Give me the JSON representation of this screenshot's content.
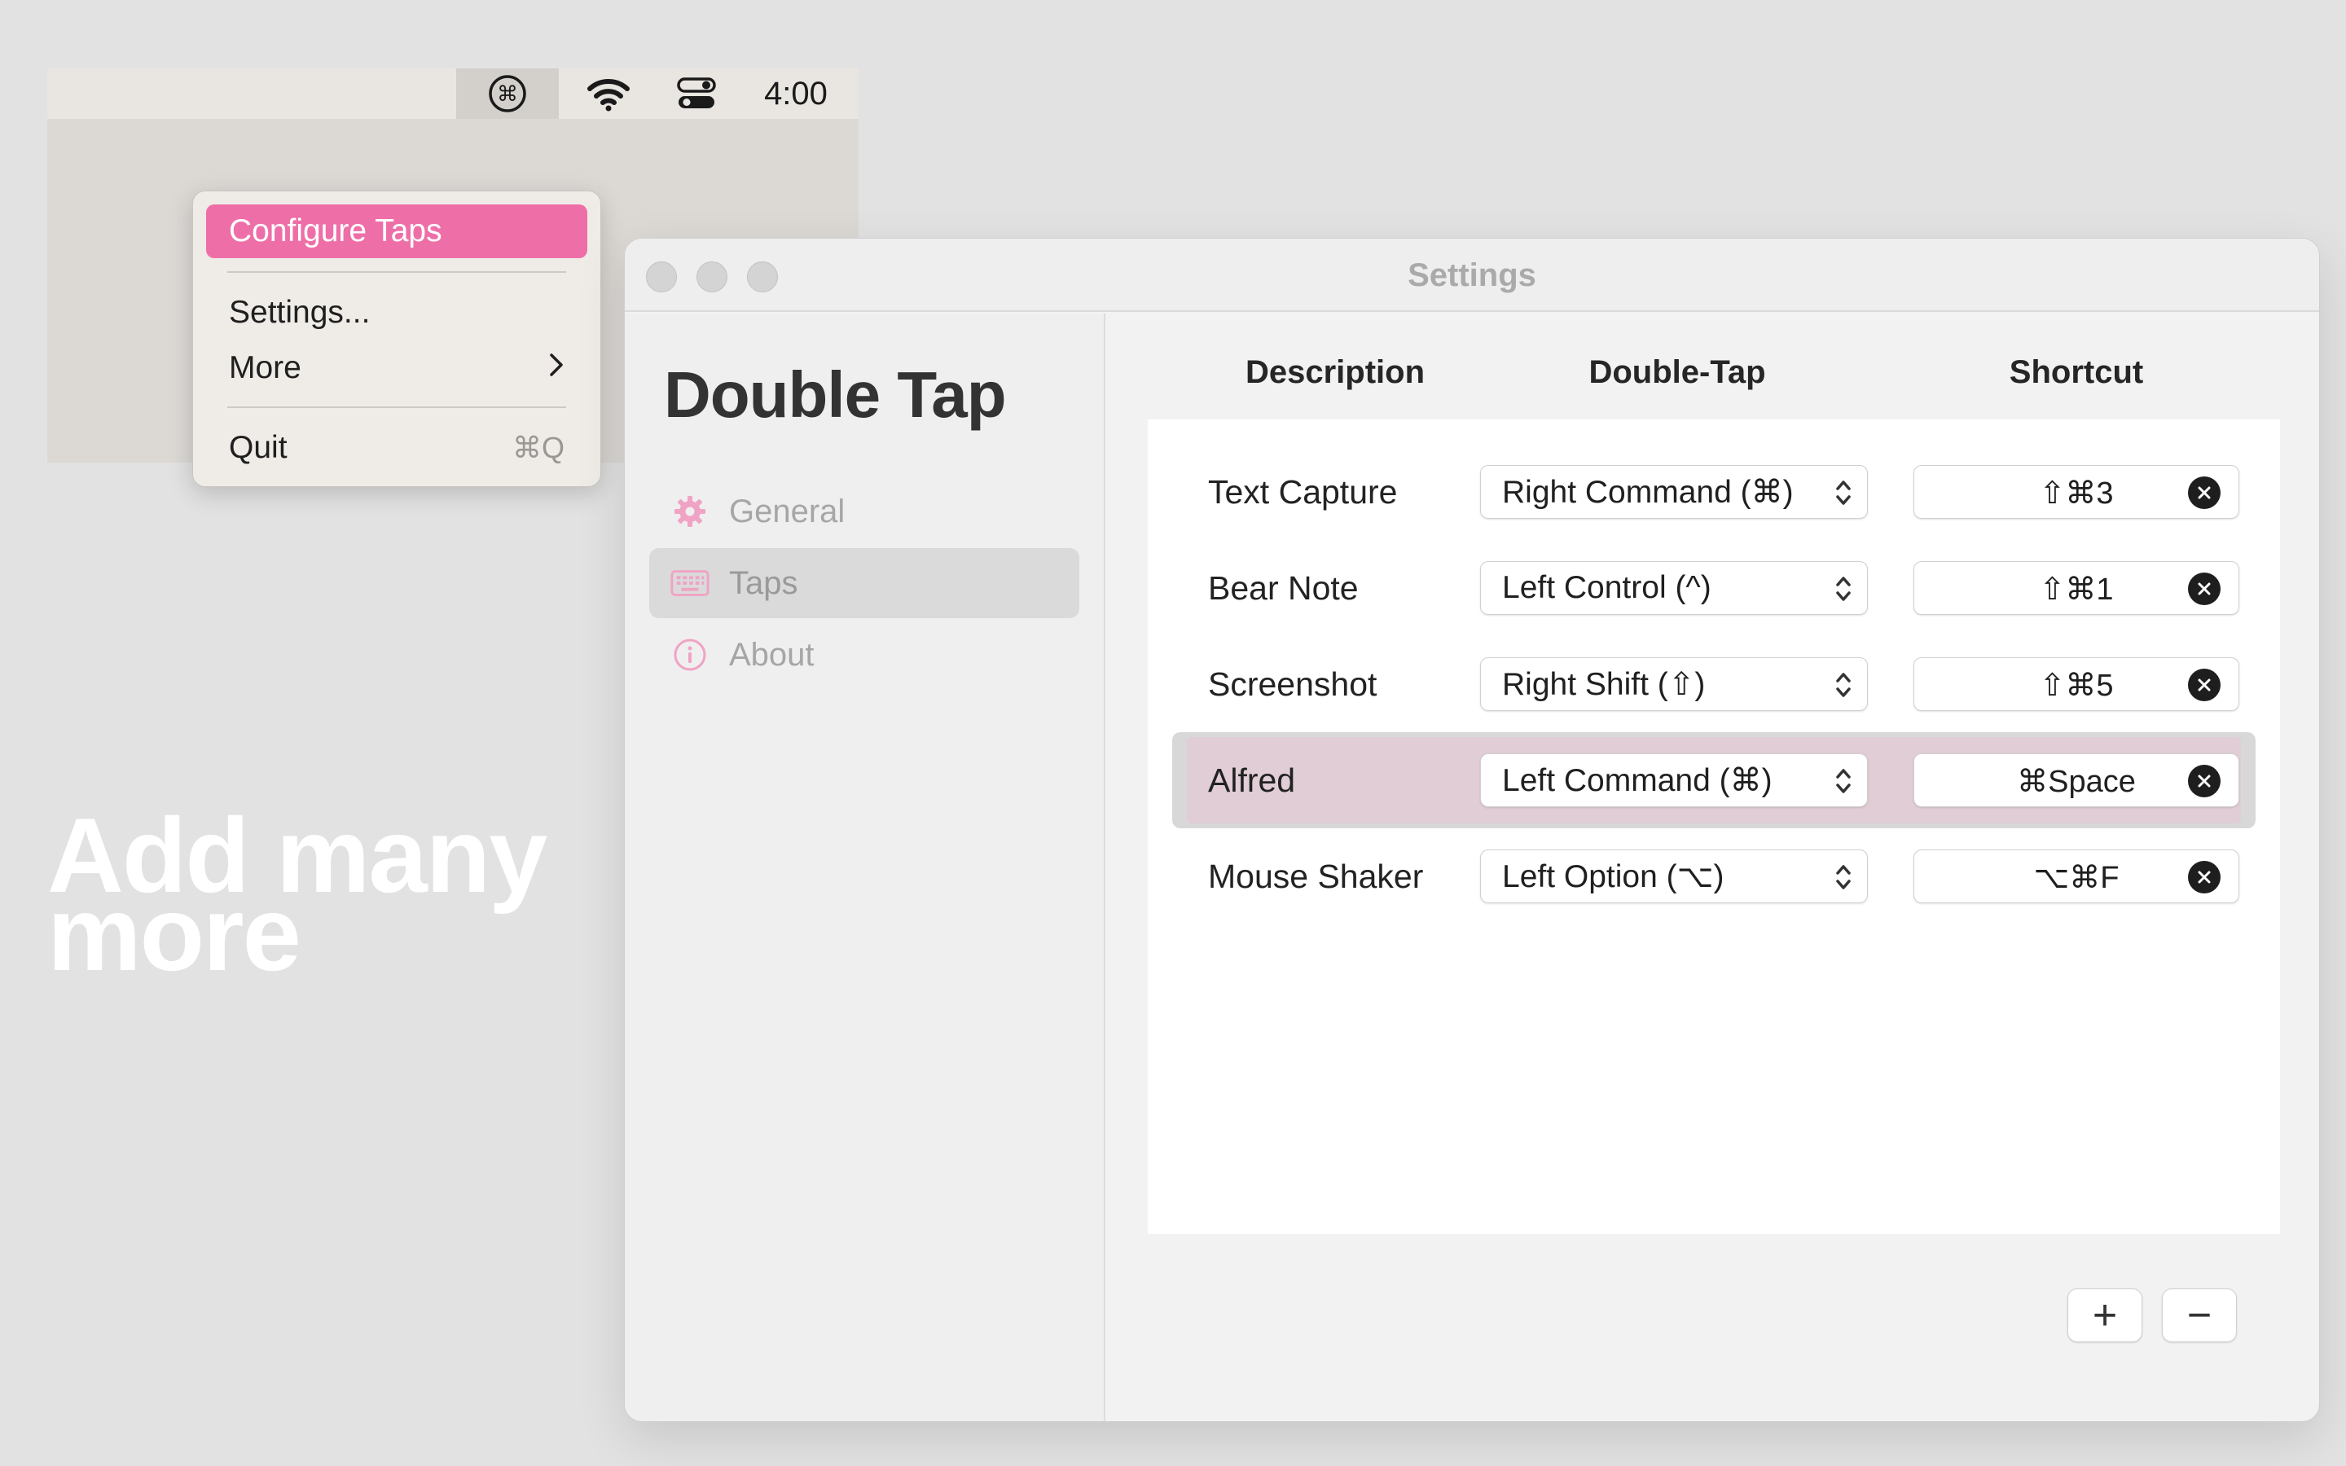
{
  "menubar": {
    "app_icon": "command-key-icon",
    "wifi_icon": "wifi-icon",
    "control_center_icon": "control-center-toggles-icon",
    "clock": "4:00"
  },
  "dropdown": {
    "items": [
      {
        "label": "Configure Taps",
        "active": true
      },
      {
        "label": "Settings..."
      },
      {
        "label": "More",
        "submenu_icon": "chevron-right-icon"
      },
      {
        "label": "Quit",
        "shortcut": "⌘Q"
      }
    ]
  },
  "headline": {
    "line1": "Add many",
    "line2": "more"
  },
  "window": {
    "title": "Settings",
    "app_title": "Double Tap",
    "sidebar": [
      {
        "label": "General",
        "icon": "gear-icon"
      },
      {
        "label": "Taps",
        "icon": "keyboard-icon",
        "selected": true
      },
      {
        "label": "About",
        "icon": "info-icon"
      }
    ],
    "columns": {
      "description": "Description",
      "double_tap": "Double-Tap",
      "shortcut": "Shortcut"
    },
    "rows": [
      {
        "description": "Text Capture",
        "double_tap": "Right Command (⌘)",
        "shortcut": "⇧⌘3"
      },
      {
        "description": "Bear Note",
        "double_tap": "Left Control (^)",
        "shortcut": "⇧⌘1"
      },
      {
        "description": "Screenshot",
        "double_tap": "Right Shift (⇧)",
        "shortcut": "⇧⌘5"
      },
      {
        "description": "Alfred",
        "double_tap": "Left Command (⌘)",
        "shortcut": "⌘Space",
        "selected": true
      },
      {
        "description": "Mouse Shaker",
        "double_tap": "Left Option (⌥)",
        "shortcut": "⌥⌘F"
      }
    ],
    "add_button": "+",
    "remove_button": "−"
  },
  "colors": {
    "accent_pink": "#ee6fa8",
    "selected_row": "#e1cdd6",
    "sidebar_icon_pink": "#f0a3c4"
  }
}
